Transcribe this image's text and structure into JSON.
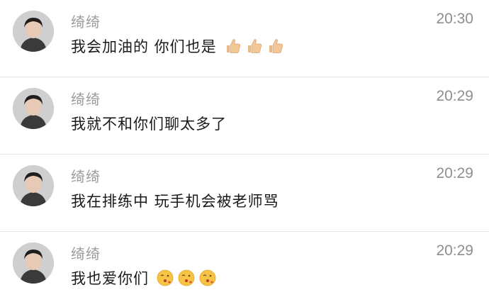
{
  "messages": [
    {
      "name": "绮绮",
      "time": "20:30",
      "text": "我会加油的 你们也是",
      "emojis": [
        "thumbs-up-icon",
        "thumbs-up-icon",
        "thumbs-up-icon"
      ]
    },
    {
      "name": "绮绮",
      "time": "20:29",
      "text": "我就不和你们聊太多了",
      "emojis": []
    },
    {
      "name": "绮绮",
      "time": "20:29",
      "text": "我在排练中 玩手机会被老师骂",
      "emojis": []
    },
    {
      "name": "绮绮",
      "time": "20:29",
      "text": "我也爱你们",
      "emojis": [
        "blowing-kiss-face-icon",
        "blowing-kiss-face-icon",
        "blowing-kiss-face-icon"
      ]
    }
  ],
  "colors": {
    "name": "#9a9a9a",
    "time": "#8e8e8e",
    "text": "#1a1a1a",
    "divider": "#e6e6e6"
  }
}
